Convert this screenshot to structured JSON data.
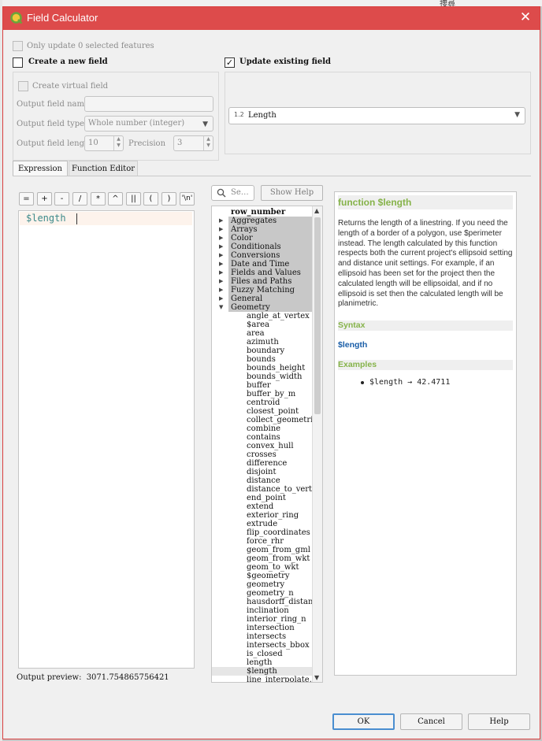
{
  "window": {
    "title": "Field Calculator",
    "background_text": "捜尋"
  },
  "options": {
    "only_update_selected": "Only update 0 selected features",
    "create_new_field": "Create a new field",
    "update_existing_field": "Update existing field",
    "update_existing_checked": "✓"
  },
  "new_field": {
    "create_virtual": "Create virtual field",
    "output_name_label": "Output field name",
    "output_name_value": "",
    "output_type_label": "Output field type",
    "output_type_value": "Whole number (integer)",
    "output_length_label": "Output field length",
    "output_length_value": "10",
    "precision_label": "Precision",
    "precision_value": "3"
  },
  "existing_field": {
    "type_badge": "1.2",
    "value": "Length"
  },
  "tabs": [
    {
      "label": "Expression"
    },
    {
      "label": "Function Editor"
    }
  ],
  "operators": [
    "=",
    "+",
    "-",
    "/",
    "*",
    "^",
    "||",
    "(",
    ")",
    "'\\n'"
  ],
  "expression": {
    "text": "$length"
  },
  "search": {
    "placeholder": "Se…"
  },
  "show_help_label": "Show Help",
  "function_tree": {
    "header": "row_number",
    "groups": [
      "Aggregates",
      "Arrays",
      "Color",
      "Conditionals",
      "Conversions",
      "Date and Time",
      "Fields and Values",
      "Files and Paths",
      "Fuzzy Matching",
      "General",
      "Geometry"
    ],
    "geometry_functions": [
      "angle_at_vertex",
      "$area",
      "area",
      "azimuth",
      "boundary",
      "bounds",
      "bounds_height",
      "bounds_width",
      "buffer",
      "buffer_by_m",
      "centroid",
      "closest_point",
      "collect_geometries",
      "combine",
      "contains",
      "convex_hull",
      "crosses",
      "difference",
      "disjoint",
      "distance",
      "distance_to_vertex",
      "end_point",
      "extend",
      "exterior_ring",
      "extrude",
      "flip_coordinates",
      "force_rhr",
      "geom_from_gml",
      "geom_from_wkt",
      "geom_to_wkt",
      "$geometry",
      "geometry",
      "geometry_n",
      "hausdorff_distance",
      "inclination",
      "interior_ring_n",
      "intersection",
      "intersects",
      "intersects_bbox",
      "is_closed",
      "length",
      "$length",
      "line_interpolate…"
    ]
  },
  "help": {
    "title": "function $length",
    "description": "Returns the length of a linestring. If you need the length of a border of a polygon, use $perimeter instead. The length calculated by this function respects both the current project's ellipsoid setting and distance unit settings. For example, if an ellipsoid has been set for the project then the calculated length will be ellipsoidal, and if no ellipsoid is set then the calculated length will be planimetric.",
    "syntax_label": "Syntax",
    "syntax": "$length",
    "examples_label": "Examples",
    "example": "$length → 42.4711"
  },
  "preview": {
    "label": "Output preview:",
    "value": "3071.754865756421"
  },
  "buttons": {
    "ok": "OK",
    "cancel": "Cancel",
    "help": "Help"
  },
  "colors": {
    "titlebar": "#dd4b4b",
    "help_heading": "#86b34a",
    "syntax": "#1a5ea8",
    "code": "#3c8a8a"
  }
}
